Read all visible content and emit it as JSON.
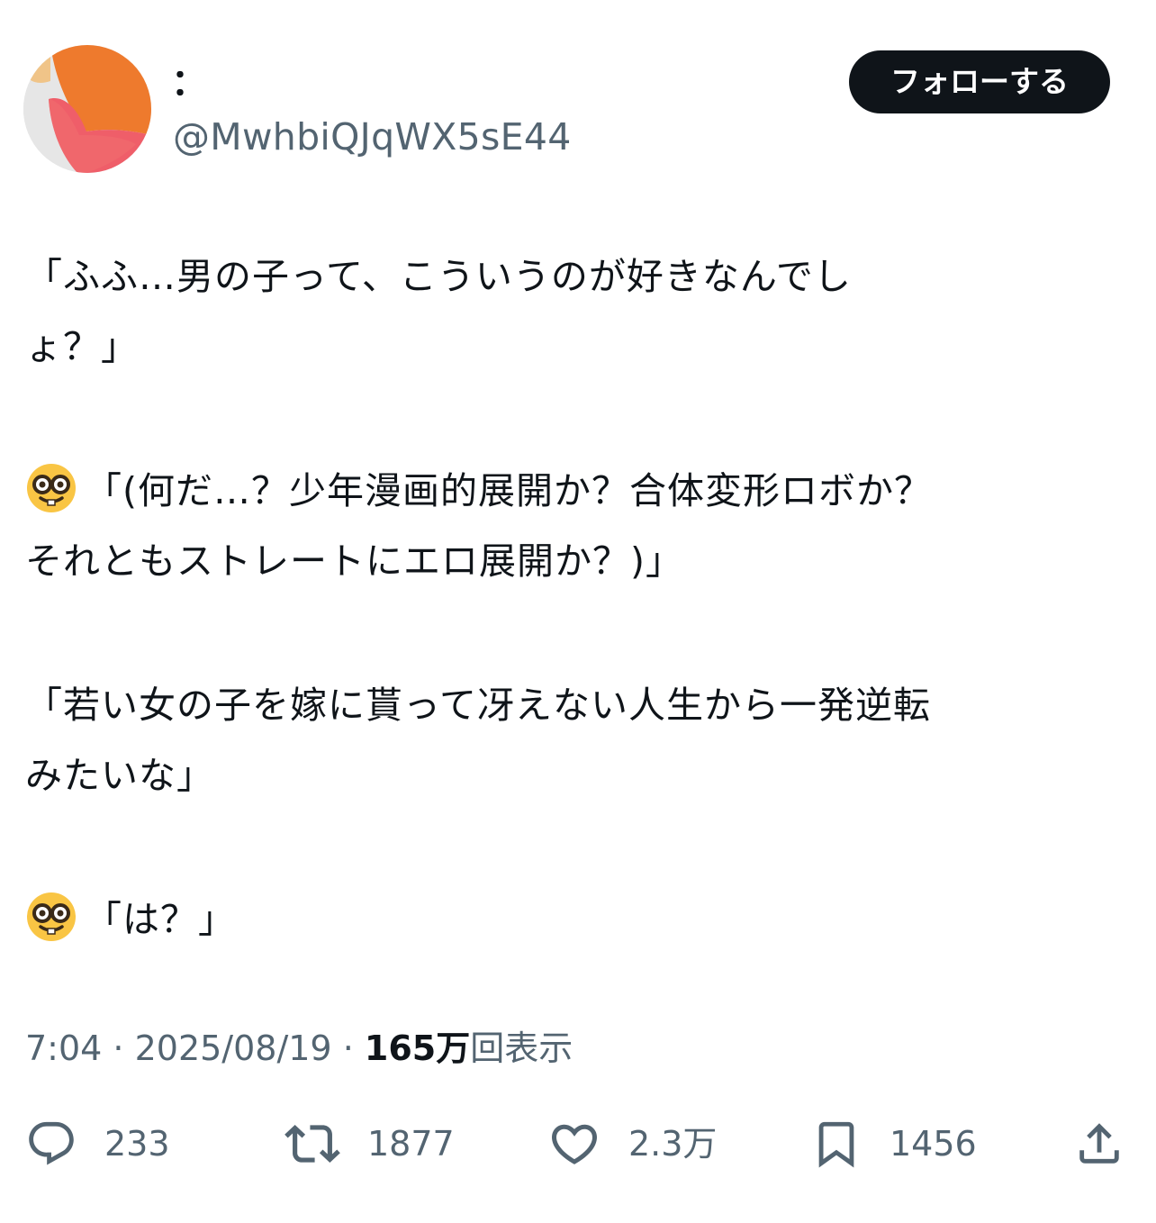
{
  "colors": {
    "text": "#0f1419",
    "secondary": "#536471",
    "follow_bg": "#0f1419",
    "avatar_orange": "#ee7a2d",
    "avatar_pink": "#ef5e69",
    "avatar_gray": "#e6e6e6"
  },
  "user": {
    "display_name": "：",
    "handle": "@MwhbiQJqWX5sE44",
    "avatar_icon": "gradient-avatar"
  },
  "header": {
    "follow_label": "フォローする"
  },
  "tweet": {
    "lines": [
      "「ふふ…男の子って、こういうのが好きなんでし",
      "ょ？」",
      "「(何だ…？少年漫画的展開か？合体変形ロボか？",
      "それともストレートにエロ展開か？)」",
      "「若い女の子を嫁に貰って冴えない人生から一発逆転",
      "みたいな」",
      "「は？」"
    ],
    "emoji_icon": "nerd-face-icon"
  },
  "meta": {
    "time": "7:04",
    "separator": " · ",
    "date": "2025/08/19",
    "views_count": "165万",
    "views_label": "回表示"
  },
  "actions": {
    "replies": "233",
    "retweets": "1877",
    "likes": "2.3万",
    "bookmarks": "1456",
    "icons": [
      "reply-icon",
      "retweet-icon",
      "like-icon",
      "bookmark-icon",
      "share-icon"
    ]
  }
}
